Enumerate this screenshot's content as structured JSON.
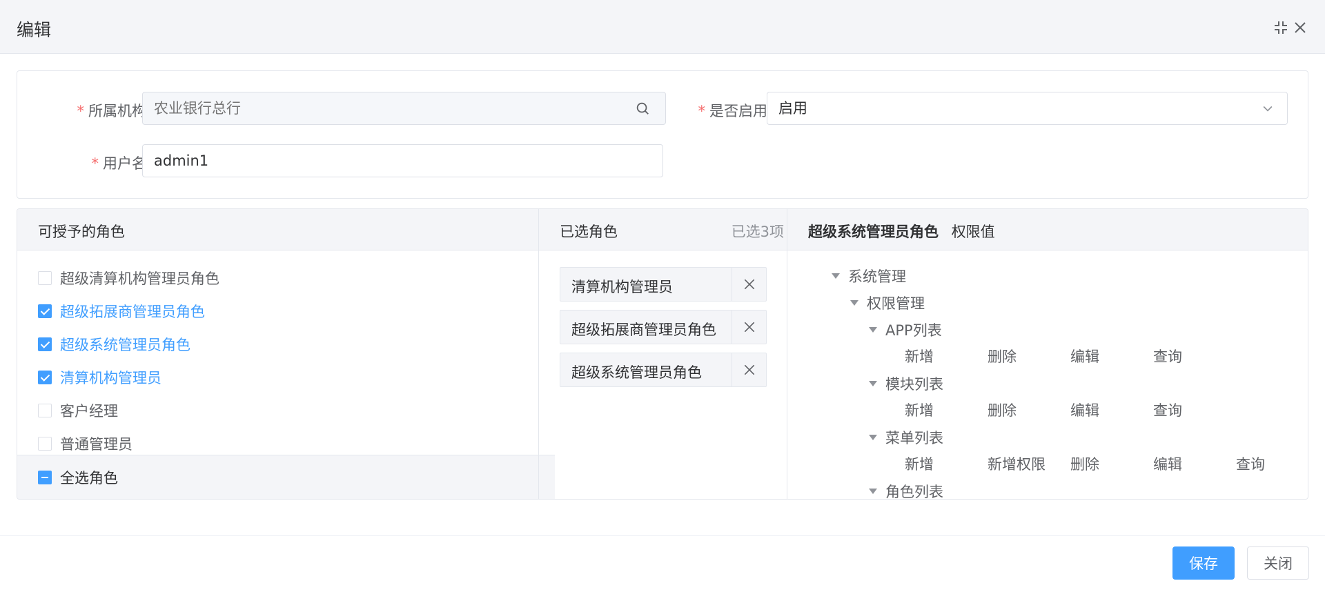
{
  "dialog": {
    "title": "编辑"
  },
  "form": {
    "org": {
      "label": "所属机构",
      "required_mark": "*",
      "placeholder": "农业银行总行"
    },
    "enabled": {
      "label": "是否启用",
      "required_mark": "*",
      "value": "启用"
    },
    "username": {
      "label": "用户名",
      "required_mark": "*",
      "value": "admin1"
    }
  },
  "available_roles": {
    "title": "可授予的角色",
    "items": [
      {
        "label": "超级清算机构管理员角色",
        "checked": false
      },
      {
        "label": "超级拓展商管理员角色",
        "checked": true
      },
      {
        "label": "超级系统管理员角色",
        "checked": true
      },
      {
        "label": "清算机构管理员",
        "checked": true
      },
      {
        "label": "客户经理",
        "checked": false
      },
      {
        "label": "普通管理员",
        "checked": false
      }
    ],
    "select_all_label": "全选角色"
  },
  "selected_roles": {
    "title": "已选角色",
    "count_text": "已选3项",
    "items": [
      "清算机构管理员",
      "超级拓展商管理员角色",
      "超级系统管理员角色"
    ]
  },
  "permissions": {
    "role_name": "超级系统管理员角色",
    "suffix": "权限值",
    "tree": {
      "root": "系统管理",
      "group": "权限管理",
      "lists": [
        {
          "name": "APP列表",
          "perms": [
            "新增",
            "删除",
            "编辑",
            "查询"
          ]
        },
        {
          "name": "模块列表",
          "perms": [
            "新增",
            "删除",
            "编辑",
            "查询"
          ]
        },
        {
          "name": "菜单列表",
          "perms": [
            "新增",
            "新增权限",
            "删除",
            "编辑",
            "查询"
          ]
        },
        {
          "name": "角色列表",
          "perms": []
        }
      ]
    }
  },
  "footer": {
    "save_label": "保存",
    "close_label": "关闭"
  },
  "colors": {
    "primary": "#409eff",
    "required": "#f56c6c",
    "header_bg": "#f4f5f8"
  }
}
